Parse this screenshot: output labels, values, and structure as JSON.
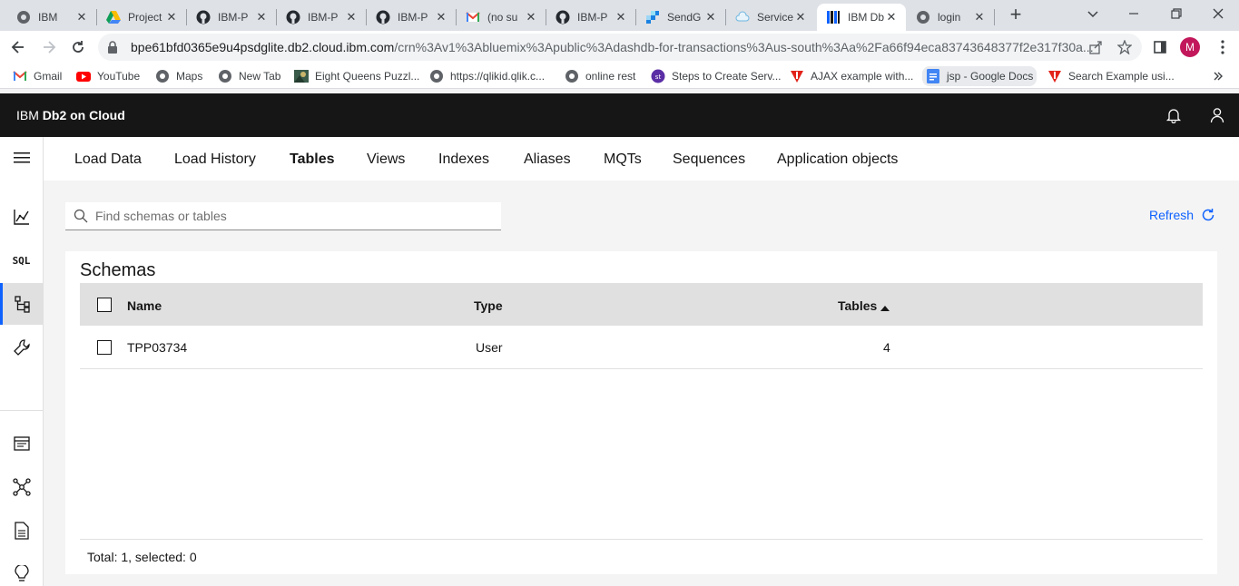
{
  "browser": {
    "tabs": [
      {
        "label": "IBM",
        "icon": "globe-icon"
      },
      {
        "label": "Project",
        "icon": "google-drive-icon"
      },
      {
        "label": "IBM-P",
        "icon": "github-icon"
      },
      {
        "label": "IBM-P",
        "icon": "github-icon"
      },
      {
        "label": "IBM-P",
        "icon": "github-icon"
      },
      {
        "label": "(no su",
        "icon": "gmail-icon"
      },
      {
        "label": "IBM-P",
        "icon": "github-icon"
      },
      {
        "label": "SendG",
        "icon": "sendgrid-icon"
      },
      {
        "label": "Service",
        "icon": "cloud-icon"
      },
      {
        "label": "IBM Db",
        "icon": "ibm-db2-icon",
        "active": true
      },
      {
        "label": "login",
        "icon": "globe-icon"
      }
    ],
    "url_host": "bpe61bfd0365e9u4psdglite.db2.cloud.ibm.com",
    "url_path": "/crn%3Av1%3Abluemix%3Apublic%3Adashdb-for-transactions%3Aus-south%3Aa%2Fa66f94eca83743648377f2e317f30a...",
    "profile_initial": "M",
    "bookmarks": [
      {
        "label": "Gmail",
        "icon": "gmail-icon"
      },
      {
        "label": "YouTube",
        "icon": "youtube-icon"
      },
      {
        "label": "Maps",
        "icon": "globe-icon"
      },
      {
        "label": "New Tab",
        "icon": "globe-icon"
      },
      {
        "label": "Eight Queens Puzzl...",
        "icon": "image-icon"
      },
      {
        "label": "https://qlikid.qlik.c...",
        "icon": "globe-icon"
      },
      {
        "label": "online rest",
        "icon": "globe-icon"
      },
      {
        "label": "Steps to Create Serv...",
        "icon": "st-icon"
      },
      {
        "label": "AJAX example with...",
        "icon": "red-triangle-icon"
      },
      {
        "label": "jsp - Google Docs",
        "icon": "google-docs-icon"
      },
      {
        "label": "Search Example usi...",
        "icon": "red-triangle-icon"
      }
    ]
  },
  "app": {
    "brand_prefix": "IBM",
    "brand_name": "Db2 on Cloud",
    "nav_tabs": [
      "Load Data",
      "Load History",
      "Tables",
      "Views",
      "Indexes",
      "Aliases",
      "MQTs",
      "Sequences",
      "Application objects"
    ],
    "active_tab": "Tables",
    "side_nav": {
      "sql_label": "SQL"
    },
    "search_placeholder": "Find schemas or tables",
    "refresh_label": "Refresh",
    "panel_title": "Schemas",
    "columns": {
      "name": "Name",
      "type": "Type",
      "tables": "Tables"
    },
    "rows": [
      {
        "name": "TPP03734",
        "type": "User",
        "tables": "4"
      }
    ],
    "footer": "Total: 1, selected: 0",
    "accent_color": "#0f62fe"
  }
}
